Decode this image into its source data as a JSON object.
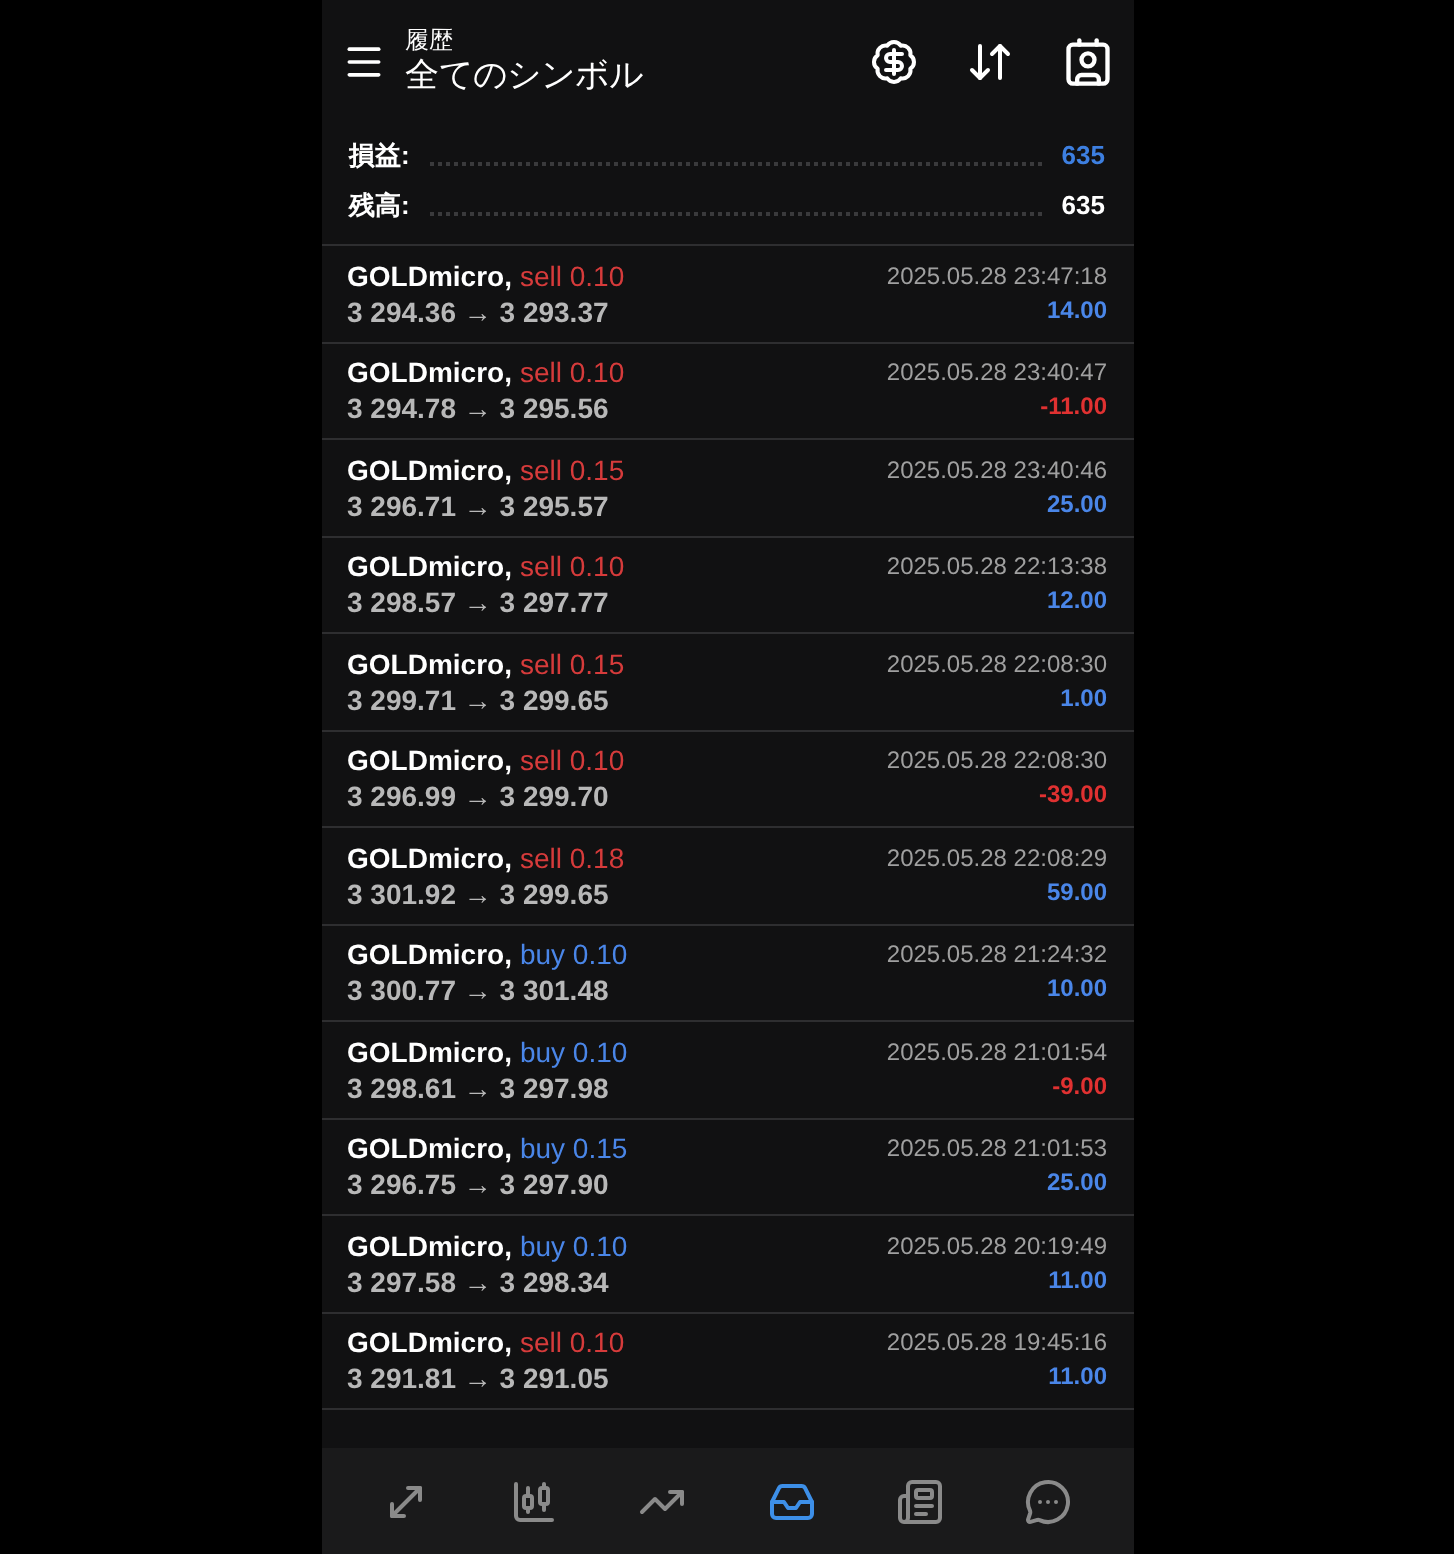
{
  "header": {
    "subtitle": "履歴",
    "title": "全てのシンボル"
  },
  "summary": [
    {
      "label": "損益:",
      "value": "635",
      "kind": "accent"
    },
    {
      "label": "残高:",
      "value": "635",
      "kind": "plain"
    }
  ],
  "deals": [
    {
      "symbol": "GOLDmicro,",
      "side": "sell 0.10",
      "kind": "sell",
      "prices": "3 294.36 → 3 293.37",
      "time": "2025.05.28 23:47:18",
      "profit": "14.00",
      "loss": false
    },
    {
      "symbol": "GOLDmicro,",
      "side": "sell 0.10",
      "kind": "sell",
      "prices": "3 294.78 → 3 295.56",
      "time": "2025.05.28 23:40:47",
      "profit": "-11.00",
      "loss": true
    },
    {
      "symbol": "GOLDmicro,",
      "side": "sell 0.15",
      "kind": "sell",
      "prices": "3 296.71 → 3 295.57",
      "time": "2025.05.28 23:40:46",
      "profit": "25.00",
      "loss": false
    },
    {
      "symbol": "GOLDmicro,",
      "side": "sell 0.10",
      "kind": "sell",
      "prices": "3 298.57 → 3 297.77",
      "time": "2025.05.28 22:13:38",
      "profit": "12.00",
      "loss": false
    },
    {
      "symbol": "GOLDmicro,",
      "side": "sell 0.15",
      "kind": "sell",
      "prices": "3 299.71 → 3 299.65",
      "time": "2025.05.28 22:08:30",
      "profit": "1.00",
      "loss": false
    },
    {
      "symbol": "GOLDmicro,",
      "side": "sell 0.10",
      "kind": "sell",
      "prices": "3 296.99 → 3 299.70",
      "time": "2025.05.28 22:08:30",
      "profit": "-39.00",
      "loss": true
    },
    {
      "symbol": "GOLDmicro,",
      "side": "sell 0.18",
      "kind": "sell",
      "prices": "3 301.92 → 3 299.65",
      "time": "2025.05.28 22:08:29",
      "profit": "59.00",
      "loss": false
    },
    {
      "symbol": "GOLDmicro,",
      "side": "buy 0.10",
      "kind": "buy",
      "prices": "3 300.77 → 3 301.48",
      "time": "2025.05.28 21:24:32",
      "profit": "10.00",
      "loss": false
    },
    {
      "symbol": "GOLDmicro,",
      "side": "buy 0.10",
      "kind": "buy",
      "prices": "3 298.61 → 3 297.98",
      "time": "2025.05.28 21:01:54",
      "profit": "-9.00",
      "loss": true
    },
    {
      "symbol": "GOLDmicro,",
      "side": "buy 0.15",
      "kind": "buy",
      "prices": "3 296.75 → 3 297.90",
      "time": "2025.05.28 21:01:53",
      "profit": "25.00",
      "loss": false
    },
    {
      "symbol": "GOLDmicro,",
      "side": "buy 0.10",
      "kind": "buy",
      "prices": "3 297.58 → 3 298.34",
      "time": "2025.05.28 20:19:49",
      "profit": "11.00",
      "loss": false
    },
    {
      "symbol": "GOLDmicro,",
      "side": "sell 0.10",
      "kind": "sell",
      "prices": "3 291.81 → 3 291.05",
      "time": "2025.05.28 19:45:16",
      "profit": "11.00",
      "loss": false
    }
  ],
  "nav": [
    {
      "kind": "quotes",
      "selected": false
    },
    {
      "kind": "chart",
      "selected": false
    },
    {
      "kind": "trade",
      "selected": false
    },
    {
      "kind": "history",
      "selected": true
    },
    {
      "kind": "news",
      "selected": false
    },
    {
      "kind": "chat",
      "selected": false
    }
  ]
}
